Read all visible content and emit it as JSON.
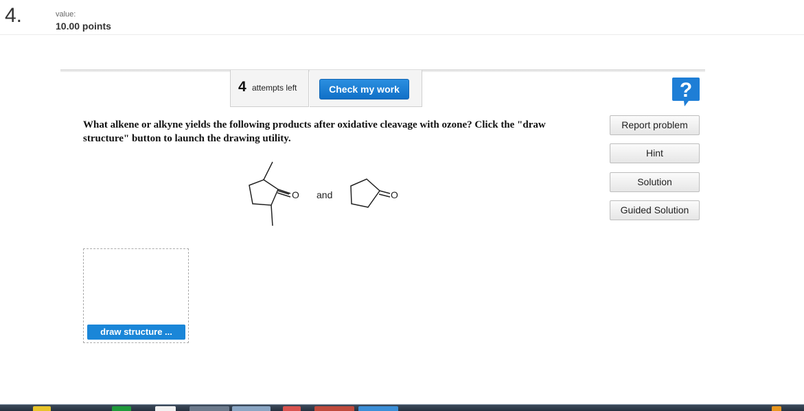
{
  "question": {
    "number": "4.",
    "value_label": "value:",
    "value": "10.00 points"
  },
  "toolbar": {
    "attempts_count": "4",
    "attempts_text": "attempts left",
    "check_label": "Check my work",
    "help_icon": "question-mark-icon",
    "help_glyph": "?"
  },
  "prompt": {
    "text": "What alkene or alkyne yields the following products after oxidative cleavage with ozone? Click the \"draw structure\" button to launch the drawing utility."
  },
  "side_buttons": {
    "report": "Report problem",
    "hint": "Hint",
    "solution": "Solution",
    "guided": "Guided Solution"
  },
  "structures": {
    "oxygen_label": "O",
    "and_label": "and"
  },
  "drawing": {
    "button_label": "draw structure ..."
  },
  "colors": {
    "accent_blue": "#1a86d8",
    "help_blue": "#1e7ed6"
  }
}
